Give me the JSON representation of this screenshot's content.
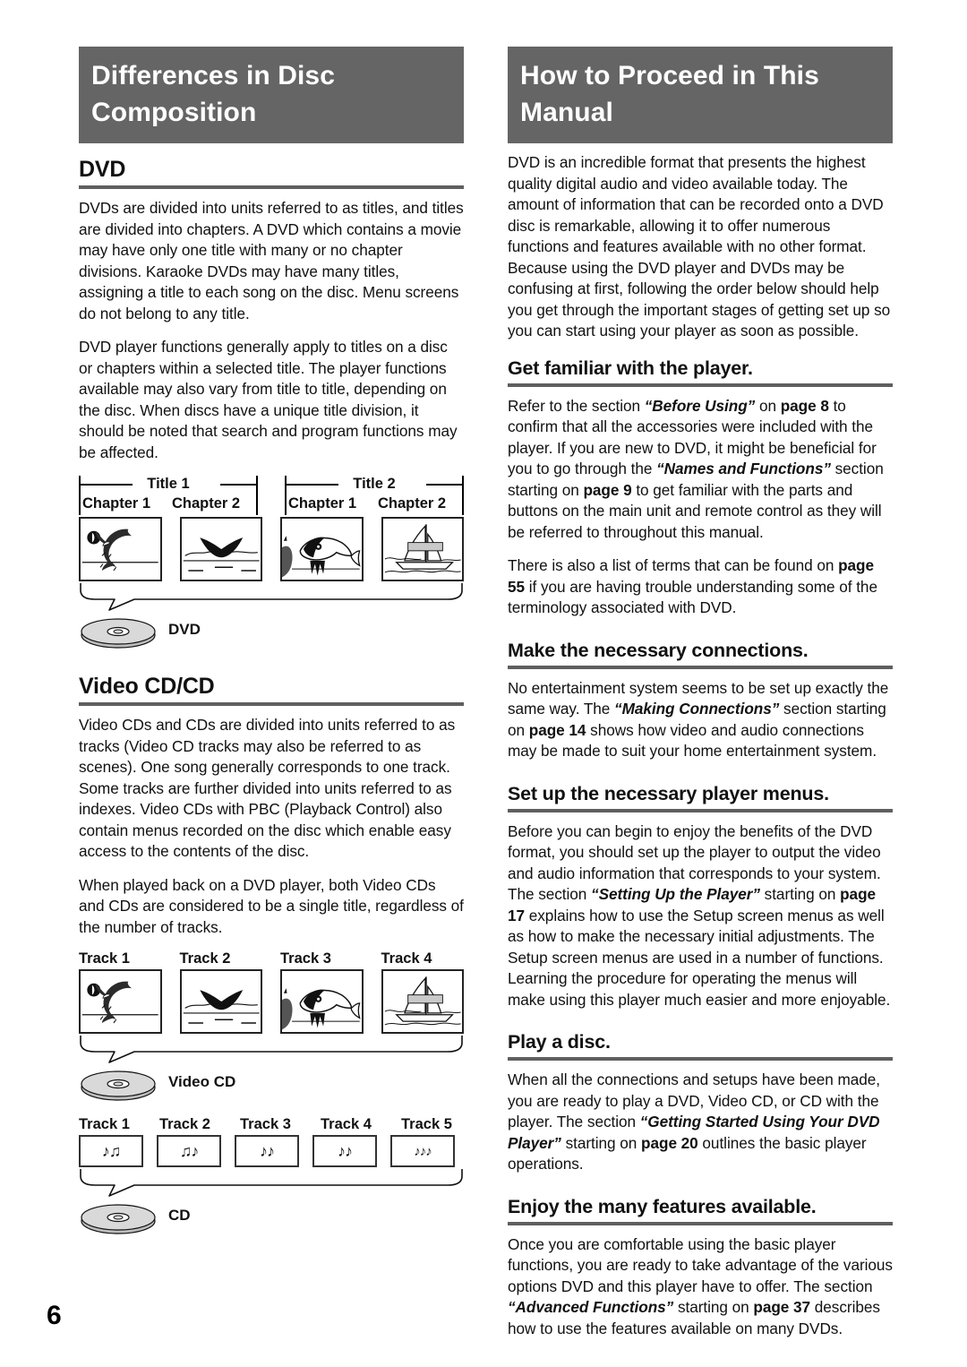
{
  "page": {
    "number": "6",
    "accent_gray": "#656565",
    "rule_gray": "#5f5f5f"
  },
  "left_column": {
    "banner": {
      "line1": "Differences in Disc",
      "line2": "Composition"
    },
    "dvd": {
      "heading": "DVD",
      "paragraphs": [
        "DVDs are divided into units referred to as titles, and titles are divided into chapters. A DVD which contains a movie may have only one title with many or no chapter divisions. Karaoke DVDs may have many titles, assigning a title to each song on the disc. Menu screens do not belong to any title.",
        "DVD player functions generally apply to titles on a disc or chapters within a selected title. The player functions available may also vary from title to title, depending on the disc. When discs have a unique title division, it should be noted that search and program functions may be affected."
      ],
      "figure": {
        "titles": [
          {
            "label": "Title 1",
            "chapters": [
              "Chapter 1",
              "Chapter 2"
            ]
          },
          {
            "label": "Title 2",
            "chapters": [
              "Chapter 1",
              "Chapter 2"
            ]
          }
        ],
        "thumbnails": [
          "dolphin-scene",
          "whale-tail-scene",
          "fish-scene",
          "sailboat-scene"
        ],
        "disc_label": "DVD"
      }
    },
    "videocd": {
      "heading": "Video CD/CD",
      "paragraphs": [
        "Video CDs and CDs are divided into units referred to as tracks (Video CD tracks may also be referred to as scenes). One song generally corresponds to one track. Some tracks are further divided into units referred to as indexes. Video CDs with PBC (Playback Control) also contain menus recorded on the disc which enable easy access to the contents of the disc.",
        "When played back on a DVD player, both Video CDs and CDs are considered to be a single title, regardless of the number of tracks."
      ],
      "figure_video": {
        "track_labels": [
          "Track 1",
          "Track 2",
          "Track 3",
          "Track 4"
        ],
        "thumbnails": [
          "dolphin-scene",
          "whale-tail-scene",
          "fish-scene",
          "sailboat-scene"
        ],
        "disc_label": "Video CD"
      },
      "figure_cd": {
        "track_labels": [
          "Track 1",
          "Track 2",
          "Track 3",
          "Track 4",
          "Track 5"
        ],
        "note_boxes": [
          "♪♫",
          "♫♪",
          "♪♪",
          "♪♪",
          "♪♪♪"
        ],
        "disc_label": "CD"
      }
    }
  },
  "right_column": {
    "banner": {
      "line1": "How to Proceed in This",
      "line2": "Manual"
    },
    "intro": "DVD is an incredible format that presents the highest quality digital audio and video available today. The amount of information that can be recorded onto a DVD disc is remarkable, allowing it to offer numerous functions and features available with no other format. Because using the DVD player and DVDs may be confusing at first, following the order below should help you get through the important stages of getting set up so you can start using your player as soon as possible.",
    "steps": [
      {
        "heading": "Get familiar with the player.",
        "paragraphs": [
          {
            "runs": [
              {
                "t": "Refer to the section ",
                "s": "n"
              },
              {
                "t": "“Before Using”",
                "s": "i"
              },
              {
                "t": " on ",
                "s": "n"
              },
              {
                "t": "page 8",
                "s": "b"
              },
              {
                "t": " to confirm that all the accessories were included with the player. If you are new to DVD, it might be beneficial for you to go through the ",
                "s": "n"
              },
              {
                "t": "“Names and Functions”",
                "s": "i"
              },
              {
                "t": " section starting on ",
                "s": "n"
              },
              {
                "t": "page 9",
                "s": "b"
              },
              {
                "t": " to get familiar with the parts and buttons on the main unit and remote control as they will be referred to throughout this manual.",
                "s": "n"
              }
            ]
          },
          {
            "runs": [
              {
                "t": "There is also a list of terms that can be found on ",
                "s": "n"
              },
              {
                "t": "page 55",
                "s": "b"
              },
              {
                "t": " if you are having trouble understanding some of the terminology associated with DVD.",
                "s": "n"
              }
            ]
          }
        ]
      },
      {
        "heading": "Make the necessary connections.",
        "paragraphs": [
          {
            "runs": [
              {
                "t": "No entertainment system seems to be set up exactly the same way. The ",
                "s": "n"
              },
              {
                "t": "“Making Connections”",
                "s": "i"
              },
              {
                "t": " section starting on ",
                "s": "n"
              },
              {
                "t": "page 14",
                "s": "b"
              },
              {
                "t": " shows how video and audio connections may be made to suit your home entertainment system.",
                "s": "n"
              }
            ]
          }
        ]
      },
      {
        "heading": "Set up the necessary player menus.",
        "paragraphs": [
          {
            "runs": [
              {
                "t": "Before you can begin to enjoy the benefits of the DVD format, you should set up the player to output the video and audio information that corresponds to your system. The section ",
                "s": "n"
              },
              {
                "t": "“Setting Up the Player”",
                "s": "i"
              },
              {
                "t": " starting on ",
                "s": "n"
              },
              {
                "t": "page 17",
                "s": "b"
              },
              {
                "t": " explains how to use the Setup screen menus as well as how to make the necessary initial adjustments. The Setup screen menus are used in a number of functions. Learning the procedure for operating the menus will make using this player much easier and more enjoyable.",
                "s": "n"
              }
            ]
          }
        ]
      },
      {
        "heading": "Play a disc.",
        "paragraphs": [
          {
            "runs": [
              {
                "t": "When all the connections and setups have been made, you are ready to play a DVD, Video CD, or CD with the player. The section ",
                "s": "n"
              },
              {
                "t": "“Getting Started Using Your DVD Player”",
                "s": "i"
              },
              {
                "t": " starting on ",
                "s": "n"
              },
              {
                "t": "page 20",
                "s": "b"
              },
              {
                "t": " outlines the basic player operations.",
                "s": "n"
              }
            ]
          }
        ]
      },
      {
        "heading": "Enjoy the many features available.",
        "paragraphs": [
          {
            "runs": [
              {
                "t": "Once you are comfortable using the basic player functions, you are ready to take advantage of the various options DVD and this player have to offer. The section ",
                "s": "n"
              },
              {
                "t": "“Advanced Functions”",
                "s": "i"
              },
              {
                "t": " starting on ",
                "s": "n"
              },
              {
                "t": "page 37",
                "s": "b"
              },
              {
                "t": " describes how to use the features available on many DVDs.",
                "s": "n"
              }
            ]
          }
        ]
      }
    ]
  }
}
